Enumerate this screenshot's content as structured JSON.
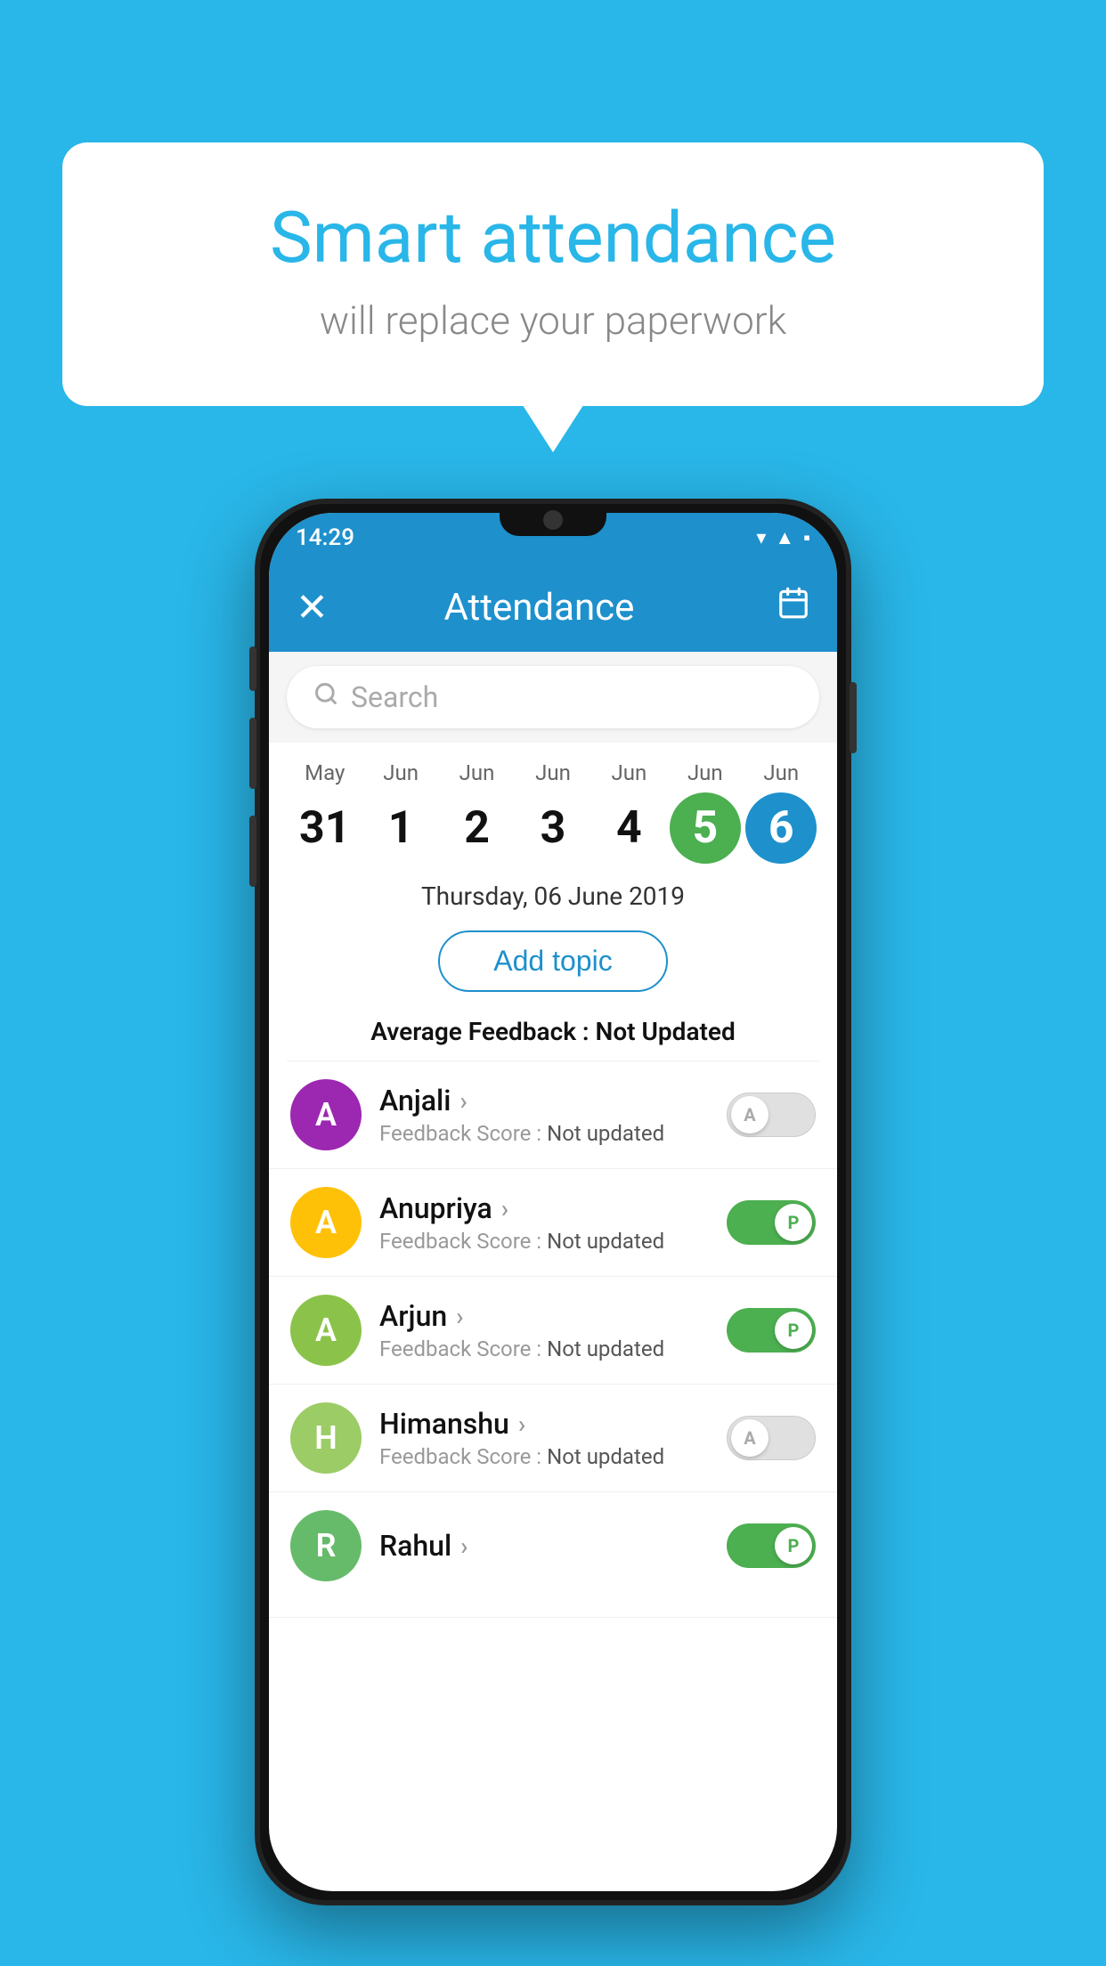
{
  "background_color": "#29b6e8",
  "speech_bubble": {
    "title": "Smart attendance",
    "subtitle": "will replace your paperwork"
  },
  "status_bar": {
    "time": "14:29",
    "icons": [
      "wifi",
      "signal",
      "battery"
    ]
  },
  "app_bar": {
    "close_label": "✕",
    "title": "Attendance",
    "calendar_icon": "calendar"
  },
  "search": {
    "placeholder": "Search"
  },
  "calendar": {
    "days": [
      {
        "month": "May",
        "date": "31",
        "state": "normal"
      },
      {
        "month": "Jun",
        "date": "1",
        "state": "normal"
      },
      {
        "month": "Jun",
        "date": "2",
        "state": "normal"
      },
      {
        "month": "Jun",
        "date": "3",
        "state": "normal"
      },
      {
        "month": "Jun",
        "date": "4",
        "state": "normal"
      },
      {
        "month": "Jun",
        "date": "5",
        "state": "today"
      },
      {
        "month": "Jun",
        "date": "6",
        "state": "selected"
      }
    ]
  },
  "selected_date": "Thursday, 06 June 2019",
  "add_topic_label": "Add topic",
  "avg_feedback_label": "Average Feedback :",
  "avg_feedback_value": "Not Updated",
  "students": [
    {
      "name": "Anjali",
      "avatar_letter": "A",
      "avatar_color": "#9c27b0",
      "feedback": "Feedback Score :",
      "feedback_value": "Not updated",
      "toggle_state": "off",
      "toggle_letter": "A"
    },
    {
      "name": "Anupriya",
      "avatar_letter": "A",
      "avatar_color": "#ffc107",
      "feedback": "Feedback Score :",
      "feedback_value": "Not updated",
      "toggle_state": "on",
      "toggle_letter": "P"
    },
    {
      "name": "Arjun",
      "avatar_letter": "A",
      "avatar_color": "#8bc34a",
      "feedback": "Feedback Score :",
      "feedback_value": "Not updated",
      "toggle_state": "on",
      "toggle_letter": "P"
    },
    {
      "name": "Himanshu",
      "avatar_letter": "H",
      "avatar_color": "#9ccc65",
      "feedback": "Feedback Score :",
      "feedback_value": "Not updated",
      "toggle_state": "off",
      "toggle_letter": "A"
    }
  ]
}
